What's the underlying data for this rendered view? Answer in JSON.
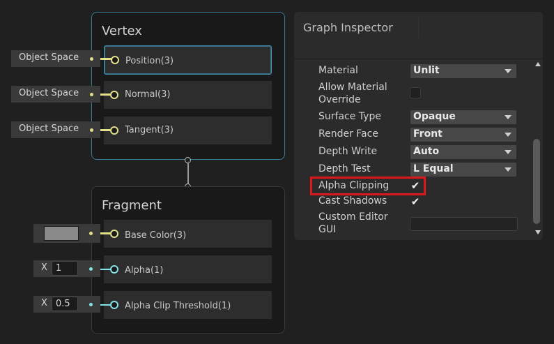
{
  "vertex": {
    "title": "Vertex",
    "slots": [
      {
        "label": "Position(3)",
        "input": "Object Space"
      },
      {
        "label": "Normal(3)",
        "input": "Object Space"
      },
      {
        "label": "Tangent(3)",
        "input": "Object Space"
      }
    ]
  },
  "fragment": {
    "title": "Fragment",
    "base_color": {
      "label": "Base Color(3)",
      "swatch_color": "#8a8a8a"
    },
    "alpha": {
      "label": "Alpha(1)",
      "axis": "X",
      "value": "1"
    },
    "alpha_clip": {
      "label": "Alpha Clip Threshold(1)",
      "axis": "X",
      "value": "0.5"
    }
  },
  "inspector": {
    "title": "Graph Inspector",
    "material": {
      "label": "Material",
      "value": "Unlit"
    },
    "allow_override": {
      "label_line1": "Allow Material",
      "label_line2": "Override",
      "checked": false
    },
    "surface_type": {
      "label": "Surface Type",
      "value": "Opaque"
    },
    "render_face": {
      "label": "Render Face",
      "value": "Front"
    },
    "depth_write": {
      "label": "Depth Write",
      "value": "Auto"
    },
    "depth_test": {
      "label": "Depth Test",
      "value": "L Equal"
    },
    "alpha_clipping": {
      "label": "Alpha Clipping",
      "checked": true,
      "mark": "✔"
    },
    "cast_shadows": {
      "label": "Cast Shadows",
      "checked": true,
      "mark": "✔"
    },
    "custom_gui": {
      "label_line1": "Custom Editor",
      "label_line2": "GUI",
      "value": ""
    }
  },
  "colors": {
    "vector3_port": "#e3e08a",
    "float_port": "#84e4e7",
    "highlight": "#e1161c"
  }
}
